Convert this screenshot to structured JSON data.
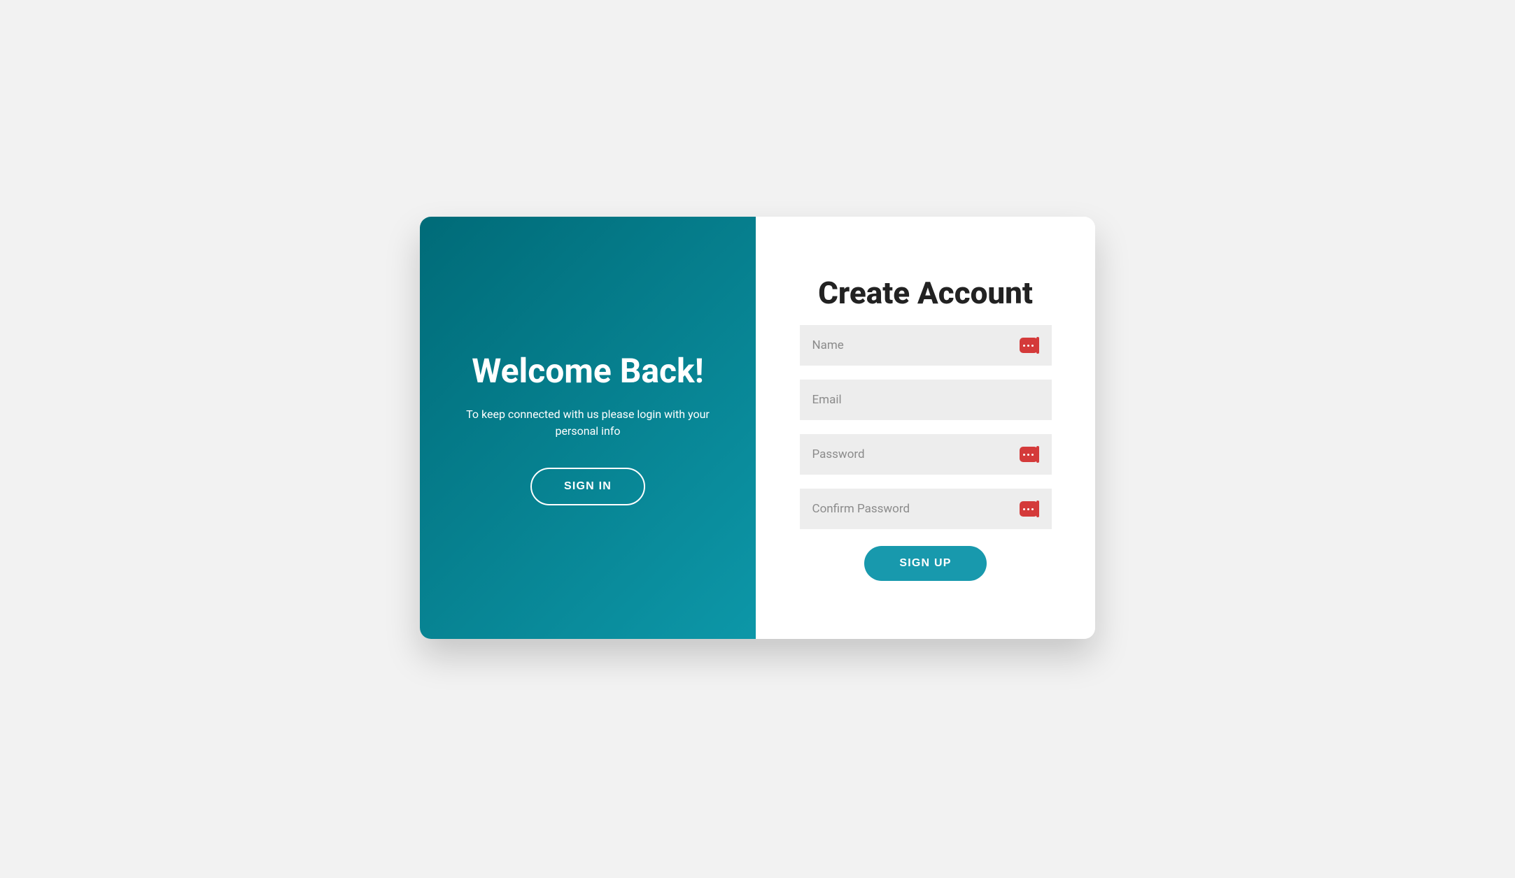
{
  "left": {
    "title": "Welcome Back!",
    "subtitle": "To keep connected with us please login with your personal info",
    "signin_label": "SIGN IN"
  },
  "right": {
    "title": "Create Account",
    "name_placeholder": "Name",
    "name_value": "",
    "email_placeholder": "Email",
    "email_value": "",
    "password_placeholder": "Password",
    "password_value": "",
    "confirm_placeholder": "Confirm Password",
    "confirm_value": "",
    "signup_label": "SIGN UP"
  },
  "colors": {
    "accent": "#1899ad",
    "panel_gradient_start": "#006b78",
    "panel_gradient_end": "#0d97a8",
    "pw_icon": "#d43a3a"
  }
}
